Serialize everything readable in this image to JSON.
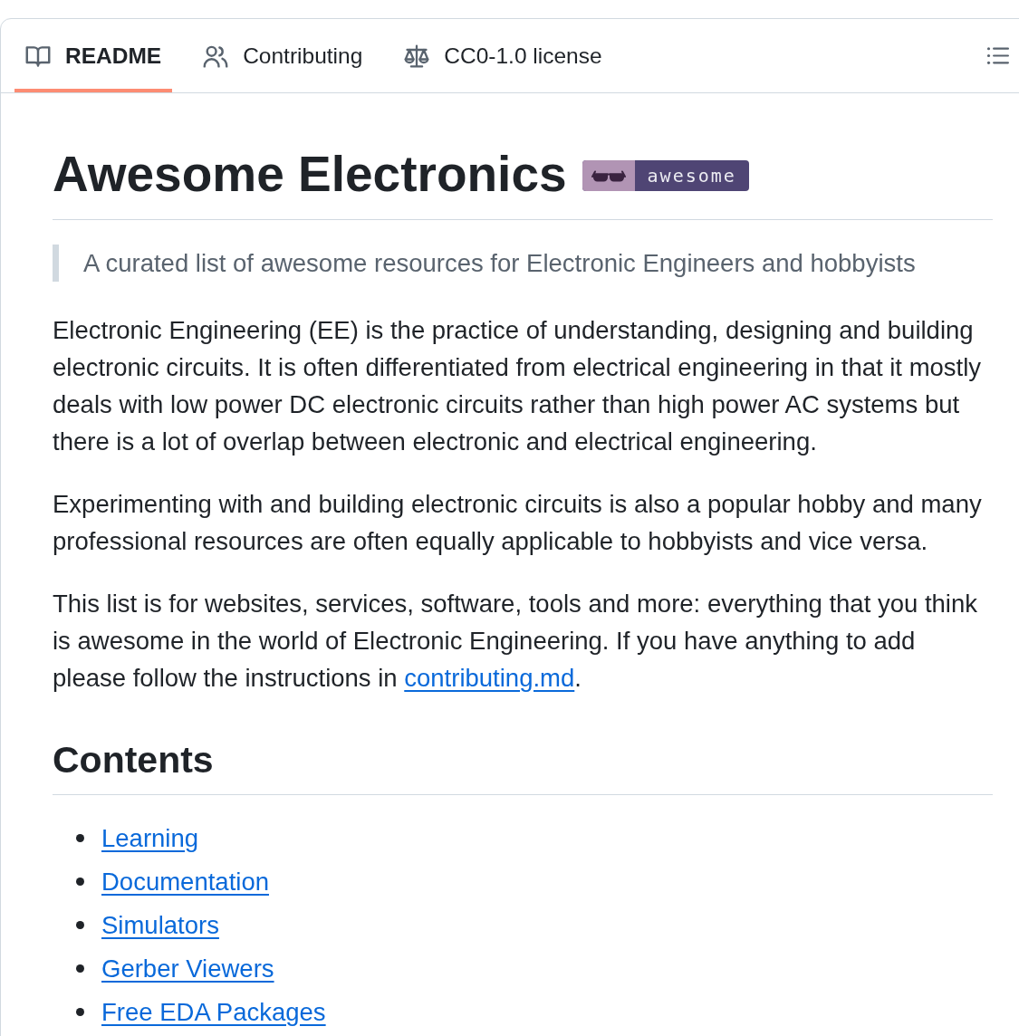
{
  "tabs": [
    {
      "label": "README",
      "selected": true
    },
    {
      "label": "Contributing",
      "selected": false
    },
    {
      "label": "CC0-1.0 license",
      "selected": false
    }
  ],
  "readme": {
    "title": "Awesome Electronics",
    "badge": "awesome",
    "tagline": "A curated list of awesome resources for Electronic Engineers and hobbyists",
    "paragraphs": [
      {
        "text": "Electronic Engineering (EE) is the practice of understanding, designing and building electronic circuits. It is often differentiated from electrical engineering in that it mostly deals with low power DC electronic circuits rather than high power AC systems but there is a lot of overlap between electronic and electrical engineering."
      },
      {
        "text": "Experimenting with and building electronic circuits is also a popular hobby and many professional resources are often equally applicable to hobbyists and vice versa."
      },
      {
        "text": "This list is for websites, services, software, tools and more: everything that you think is awesome in the world of Electronic Engineering. If you have anything to add please follow the instructions in ",
        "link": "contributing.md",
        "after": "."
      }
    ],
    "contents": {
      "heading": "Contents",
      "items": [
        "Learning",
        "Documentation",
        "Simulators",
        "Gerber Viewers",
        "Free EDA Packages"
      ]
    }
  }
}
